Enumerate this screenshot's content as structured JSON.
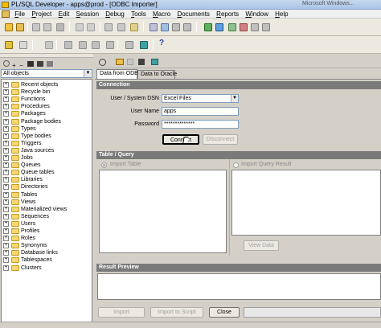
{
  "window": {
    "title": "PL/SQL Developer - apps@prod - [ODBC Importer]",
    "title_suffix": "Microsoft Windows..."
  },
  "menu": {
    "items": [
      "File",
      "Project",
      "Edit",
      "Session",
      "Debug",
      "Tools",
      "Macro",
      "Documents",
      "Reports",
      "Window",
      "Help"
    ]
  },
  "left_panel": {
    "object_filter": "All objects",
    "tree": [
      "Recent objects",
      "Recycle bin",
      "Functions",
      "Procedures",
      "Packages",
      "Package bodies",
      "Types",
      "Type bodies",
      "Triggers",
      "Java sources",
      "Jobs",
      "Queues",
      "Queue tables",
      "Libraries",
      "Directories",
      "Tables",
      "Views",
      "Materialized views",
      "Sequences",
      "Users",
      "Profiles",
      "Roles",
      "Synonyms",
      "Database links",
      "Tablespaces",
      "Clusters"
    ]
  },
  "tabs": {
    "data_from_odbc": "Data from ODBC",
    "data_to_oracle": "Data to Oracle"
  },
  "connection": {
    "section_title": "Connection",
    "dsn_label": "User / System DSN",
    "dsn_value": "Excel Files",
    "username_label": "User Name",
    "username_value": "apps",
    "password_label": "Password",
    "password_value": "**************",
    "connect_label": "Connect",
    "disconnect_label": "Disconnect"
  },
  "table_query": {
    "section_title": "Table / Query",
    "import_table_label": "Import Table",
    "import_query_label": "Import Query Result",
    "view_data_label": "View Data"
  },
  "result_preview": {
    "section_title": "Result Preview"
  },
  "footer": {
    "import_label": "Import",
    "import_script_label": "Import to Script",
    "close_label": "Close"
  },
  "colors": {
    "section_bar": "#7a7a7a",
    "folder": "#f7d774",
    "titlebar": "#a9c4e6"
  }
}
